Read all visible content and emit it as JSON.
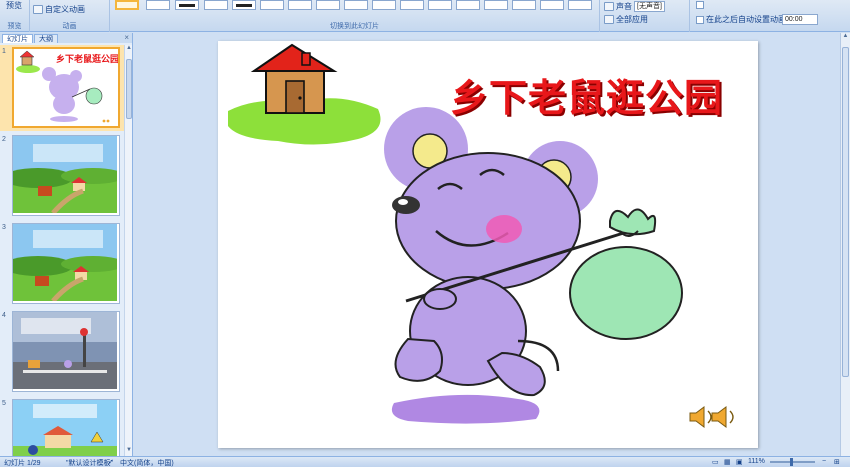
{
  "ribbon": {
    "preview_label": "预览",
    "custom_anim_label": "自定义动画",
    "group_preview": "预览",
    "group_animation": "动画",
    "group_transition": "切换到此幻灯片",
    "sound_label": "声音",
    "sound_value": "[无声音]",
    "apply_all_label": "全部应用",
    "auto_after_label": "在此之后自动设置动画效果:",
    "auto_after_value": "00:00"
  },
  "left_panel": {
    "tabs": [
      "幻灯片",
      "大纲"
    ],
    "close_glyph": "×",
    "slides": [
      {
        "num": "1",
        "title": "乡下老鼠逛公园"
      },
      {
        "num": "2",
        "title": ""
      },
      {
        "num": "3",
        "title": ""
      },
      {
        "num": "4",
        "title": ""
      },
      {
        "num": "5",
        "title": ""
      }
    ]
  },
  "slide": {
    "title": "乡下老鼠逛公园"
  },
  "statusbar": {
    "slide_pos": "幻灯片 1/29",
    "theme": "\"默认设计模板\"",
    "language": "中文(简体，中国)",
    "zoom": "111%"
  },
  "colors": {
    "title": "#e8171a",
    "mouse": "#b9a0e8",
    "bag": "#9ee6b4",
    "grass": "#8de03a",
    "selected_border": "#f0a830"
  }
}
